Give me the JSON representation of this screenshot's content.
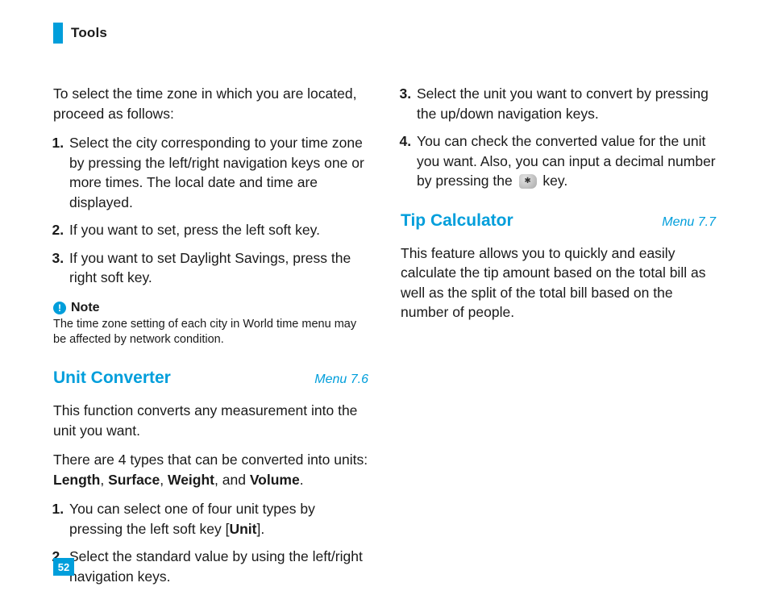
{
  "header": {
    "section": "Tools"
  },
  "page_number": "52",
  "left": {
    "intro": "To select the time zone in which you are located, proceed as follows:",
    "steps": [
      "Select the city corresponding to your time zone by pressing the left/right navigation keys one or more times. The local date and time are displayed.",
      "If you want to set, press the left soft key.",
      "If you want to set Daylight Savings, press the right soft key."
    ],
    "note_label": "Note",
    "note_body": "The time zone setting of each city in World time menu may be affected by network condition.",
    "unit_converter": {
      "title": "Unit Converter",
      "menu": "Menu 7.6",
      "p1": "This function converts any measurement into the unit you want.",
      "p2_pre": "There are 4 types that can be converted into units: ",
      "p2_bold": "Length, Surface, Weight, and Volume",
      "p2_post": ".",
      "step1_pre": "You can select one of four unit types by pressing the left soft key [",
      "step1_bold": "Unit",
      "step1_post": "].",
      "step2": "Select the standard value by using the left/right navigation keys."
    }
  },
  "right": {
    "steps": [
      "Select the unit you want to convert by pressing the up/down navigation keys.",
      ""
    ],
    "step4_pre": "You can check the converted value for the unit you want. Also, you can input a decimal number by pressing the ",
    "step4_post": " key.",
    "tip": {
      "title": "Tip Calculator",
      "menu": "Menu 7.7",
      "body": "This feature allows you to quickly and easily calculate the tip amount based on the total bill as well as the split of the total bill based on the number of people."
    }
  }
}
